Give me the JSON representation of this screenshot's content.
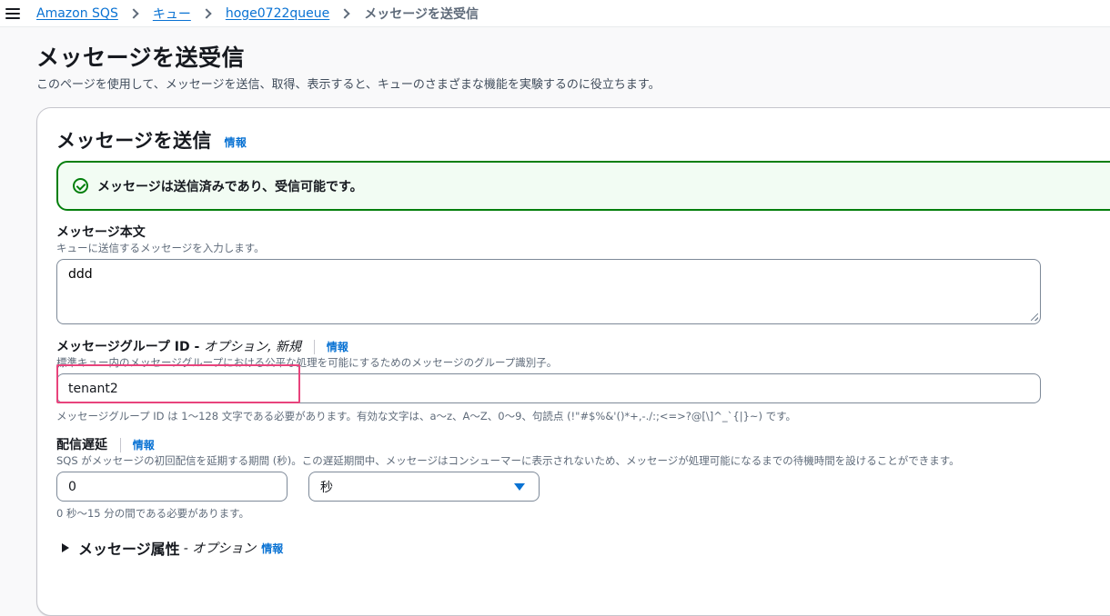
{
  "breadcrumb": {
    "items": [
      "Amazon SQS",
      "キュー",
      "hoge0722queue"
    ],
    "current": "メッセージを送受信"
  },
  "page": {
    "title": "メッセージを送受信",
    "description": "このページを使用して、メッセージを送信、取得、表示すると、キューのさまざまな機能を実験するのに役立ちます。"
  },
  "send_panel": {
    "title": "メッセージを送信",
    "info_label": "情報",
    "alert": {
      "status": "success",
      "text": "メッセージは送信済みであり、受信可能です。",
      "color": "#037f0c"
    },
    "body_field": {
      "label": "メッセージ本文",
      "description": "キューに送信するメッセージを入力します。",
      "value": "ddd"
    },
    "group_id_field": {
      "label": "メッセージグループ ID -",
      "optional": "オプション, 新規",
      "info_label": "情報",
      "description": "標準キュー内のメッセージグループにおける公平な処理を可能にするためのメッセージのグループ識別子。",
      "value": "tenant2",
      "constraint": "メッセージグループ ID は 1〜128 文字である必要があります。有効な文字は、a〜z、A〜Z、0〜9、句読点 (!\"#$%&'()*+,-./:;<=>?@[\\]^_`{|}~) です。"
    },
    "delay_field": {
      "label": "配信遅延",
      "info_label": "情報",
      "description": "SQS がメッセージの初回配信を延期する期間 (秒)。この遅延期間中、メッセージはコンシューマーに表示されないため、メッセージが処理可能になるまでの待機時間を設けることができます。",
      "value": "0",
      "unit": "秒",
      "constraint": "0 秒〜15 分の間である必要があります。"
    },
    "attributes": {
      "title": "メッセージ属性",
      "optional": "- オプション",
      "info_label": "情報"
    }
  },
  "colors": {
    "link": "#0972d3",
    "success": "#037f0c",
    "highlight": "#e8437c"
  }
}
